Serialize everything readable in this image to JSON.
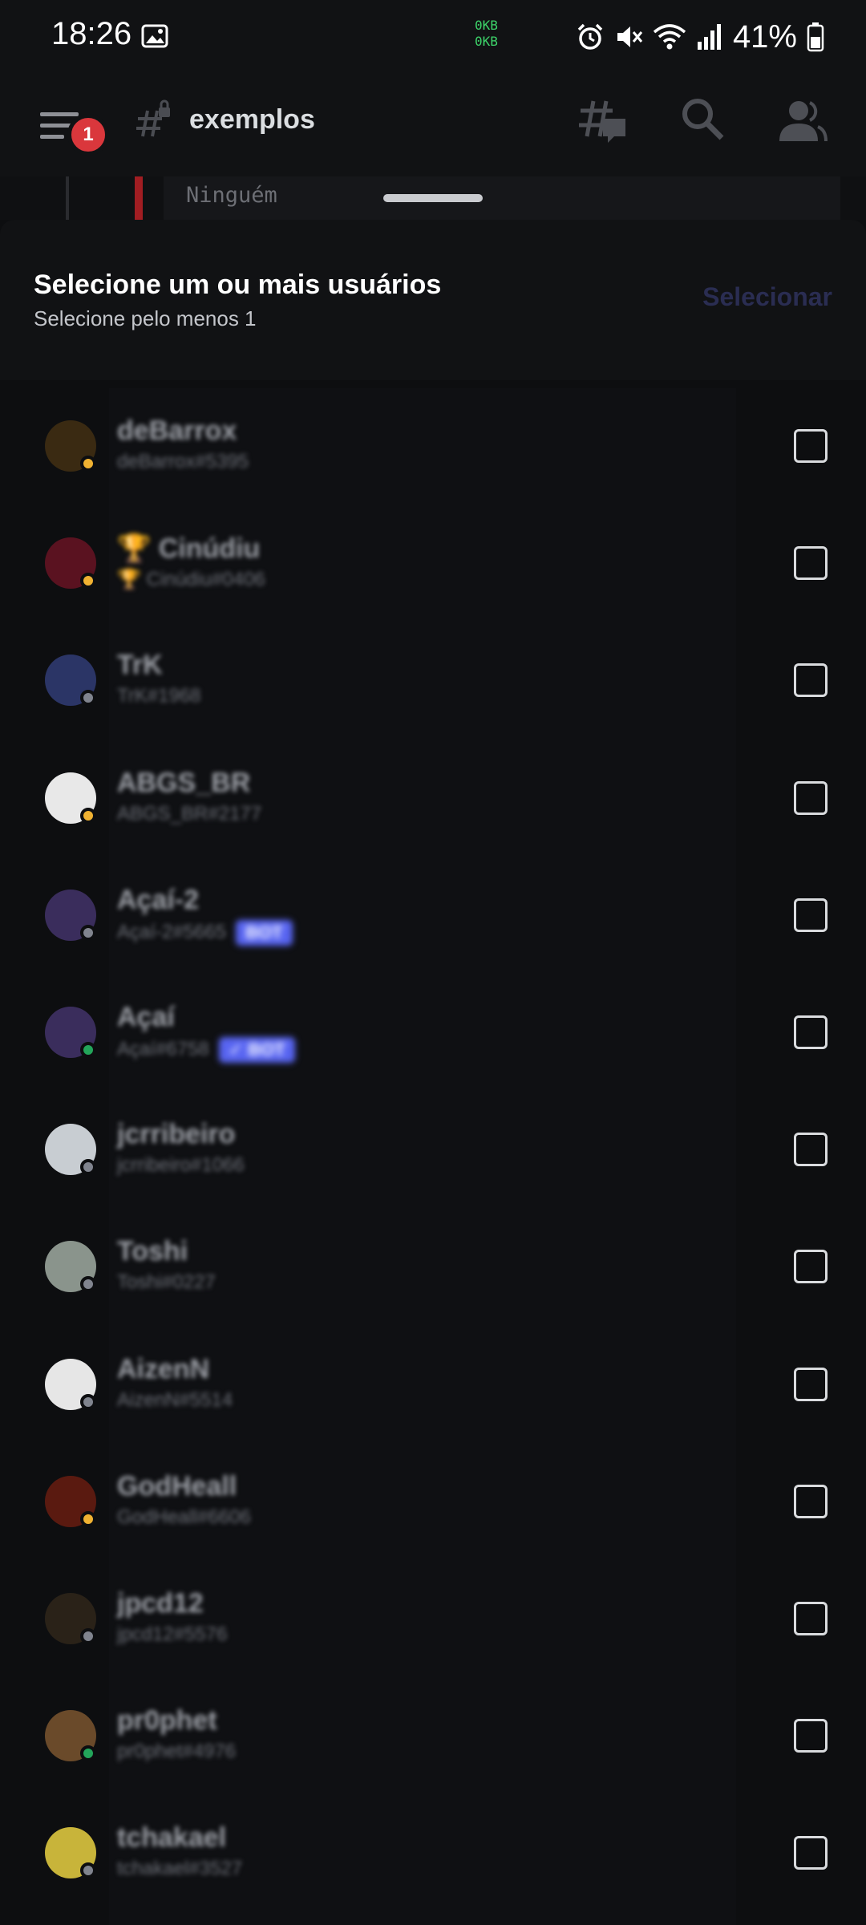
{
  "status_bar": {
    "time": "18:26",
    "net_up": "0KB",
    "net_down": "0KB",
    "battery_percent": "41%"
  },
  "channel_header": {
    "notification_count": "1",
    "channel_name": "exemplos"
  },
  "channel_peek": {
    "text": "Ninguém"
  },
  "sheet": {
    "title": "Selecione um ou mais usuários",
    "subtitle": "Selecione pelo menos 1",
    "select_button": "Selecionar"
  },
  "colors": {
    "status_online": "#23a55a",
    "status_idle": "#f0b232",
    "status_offline": "#80848e",
    "bot_badge": "#5865f2",
    "notification_badge": "#da373c"
  },
  "users": [
    {
      "display_name": "deBarrox",
      "username": "deBarrox#5395",
      "status": "idle",
      "bot": ""
    },
    {
      "display_name": "🏆 Cinúdiu",
      "username": "🏆 Cinúdiu#0406",
      "status": "idle",
      "bot": ""
    },
    {
      "display_name": "TrK",
      "username": "TrK#1968",
      "status": "offline",
      "bot": ""
    },
    {
      "display_name": "ABGS_BR",
      "username": "ABGS_BR#2177",
      "status": "idle",
      "bot": ""
    },
    {
      "display_name": "Açaí-2",
      "username": "Açaí-2#5665",
      "status": "offline",
      "bot": "BOT"
    },
    {
      "display_name": "Açaí",
      "username": "Açaí#6758",
      "status": "online",
      "bot": "✓ BOT"
    },
    {
      "display_name": "jcrribeiro",
      "username": "jcrribeiro#1066",
      "status": "offline",
      "bot": ""
    },
    {
      "display_name": "Toshi",
      "username": "Toshi#0227",
      "status": "offline",
      "bot": ""
    },
    {
      "display_name": "AizenN",
      "username": "AizenN#5514",
      "status": "offline",
      "bot": ""
    },
    {
      "display_name": "GodHeall",
      "username": "GodHeall#6606",
      "status": "idle",
      "bot": ""
    },
    {
      "display_name": "jpcd12",
      "username": "jpcd12#5576",
      "status": "offline",
      "bot": ""
    },
    {
      "display_name": "pr0phet",
      "username": "pr0phet#4976",
      "status": "online",
      "bot": ""
    },
    {
      "display_name": "tchakael",
      "username": "tchakael#3527",
      "status": "offline",
      "bot": ""
    }
  ]
}
